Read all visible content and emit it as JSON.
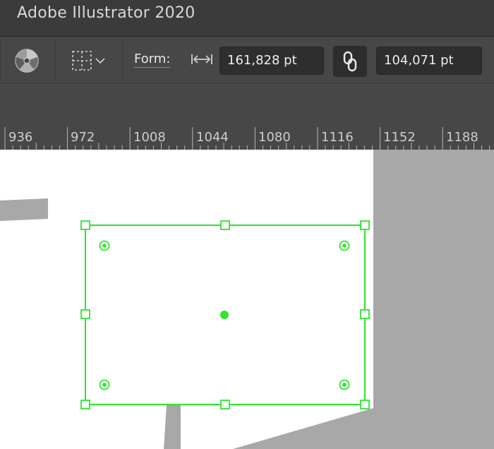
{
  "app": {
    "title": "Adobe Illustrator 2020"
  },
  "controlbar": {
    "recolor_icon": "recolor-artwork-icon",
    "align_icon": "align-to-selection-icon",
    "form_label": "Form:",
    "width_icon": "width-arrows-icon",
    "width_value": "161,828 pt",
    "link_icon": "constrain-proportions-link-icon",
    "height_value": "104,071 pt"
  },
  "ruler": {
    "labels": [
      "936",
      "972",
      "1008",
      "1044",
      "1080",
      "1116",
      "1152",
      "1188"
    ]
  },
  "colors": {
    "chrome_dark": "#3b3b3b",
    "chrome": "#474747",
    "field": "#2e2e2e",
    "selection": "#2ee62e",
    "shape_gray": "#a8a8a8",
    "canvas": "#ffffff"
  }
}
